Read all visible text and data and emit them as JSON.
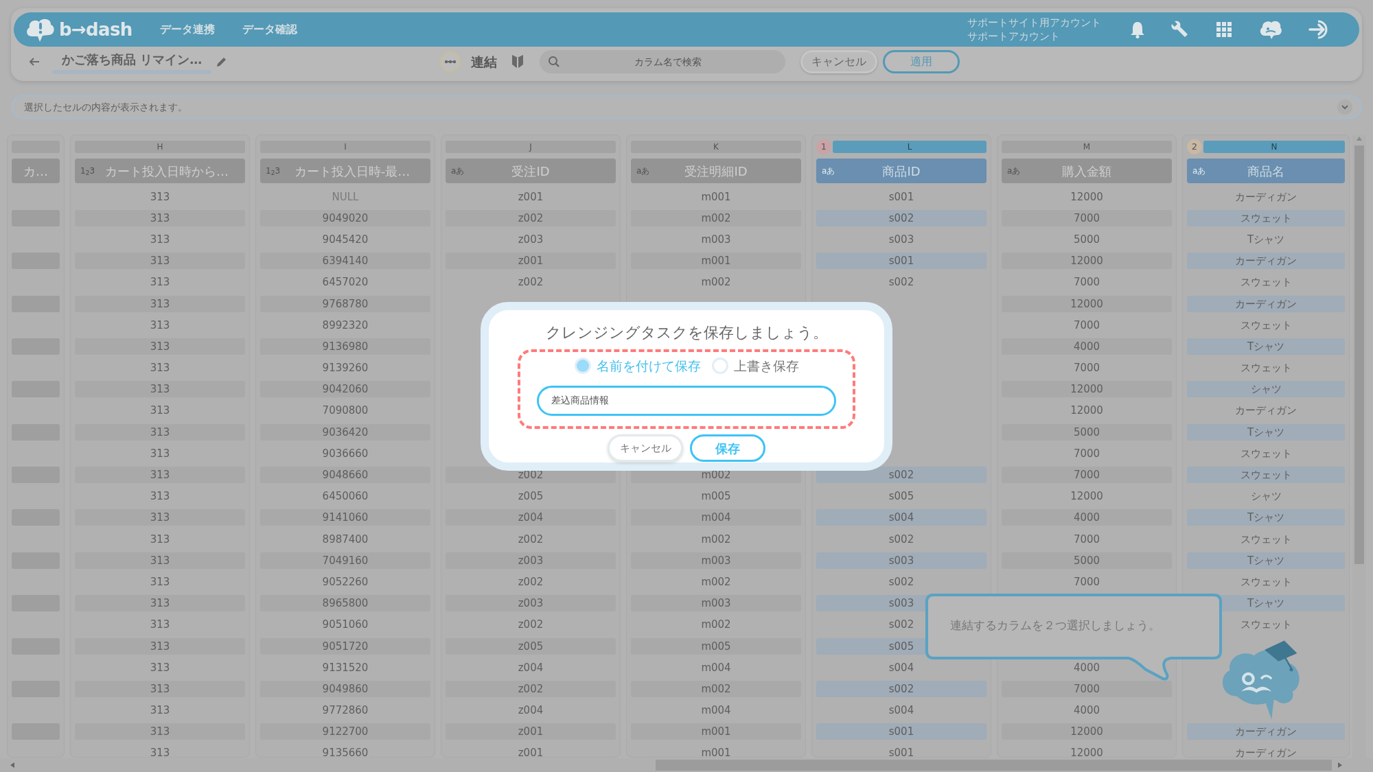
{
  "header": {
    "logo": "b→dash",
    "nav": [
      "データ連携",
      "データ確認"
    ],
    "account": [
      "サポートサイト用アカウント",
      "サポートアカウント"
    ]
  },
  "toolbar": {
    "title": "かご落ち商品 リマイン…",
    "mode": "連結",
    "search": {
      "placeholder": "カラム名で検索"
    },
    "buttons": [
      {
        "label": "キャンセル",
        "kind": "secondary"
      },
      {
        "label": "適用",
        "kind": "primary"
      }
    ]
  },
  "cell_viewer": {
    "placeholder": "選択したセルの内容が表示されます。"
  },
  "columns": [
    {
      "title": "カ…",
      "selected": false
    },
    {
      "letter": "H",
      "type_label": "1$_{2}$3",
      "title": "カート投入日時から…",
      "selected": false,
      "cells": [
        "313",
        "313",
        "313",
        "313",
        "313",
        "313",
        "313",
        "313",
        "313",
        "313",
        "313",
        "313",
        "313",
        "313",
        "313",
        "313",
        "313",
        "313",
        "313",
        "313",
        "313",
        "313",
        "313",
        "313",
        "313",
        "313",
        "313"
      ]
    },
    {
      "letter": "I",
      "type_label": "1$_{2}$3",
      "title": "カート投入日時-最…",
      "selected": false,
      "cells": [
        "NULL",
        "9049020",
        "9045420",
        "6394140",
        "6457020",
        "9768780",
        "8992320",
        "9136980",
        "9139260",
        "9042060",
        "7090800",
        "9036420",
        "9036660",
        "9048660",
        "6450060",
        "9141060",
        "8987400",
        "7049160",
        "9052260",
        "8965800",
        "9051060",
        "9051720",
        "9131520",
        "9049860",
        "9772860",
        "9122700",
        "9135660"
      ]
    },
    {
      "letter": "J",
      "type_label": "aあ",
      "title": "受注ID",
      "selected": false,
      "cells": [
        "z001",
        "z002",
        "z003",
        "z001",
        "z002",
        null,
        null,
        null,
        null,
        null,
        null,
        null,
        null,
        "z002",
        "z005",
        "z004",
        "z002",
        "z003",
        "z002",
        "z003",
        "z002",
        "z005",
        "z004",
        "z002",
        "z004",
        "z001",
        "z001"
      ]
    },
    {
      "letter": "K",
      "type_label": "aあ",
      "title": "受注明細ID",
      "selected": false,
      "cells": [
        "m001",
        "m002",
        "m003",
        "m001",
        "m002",
        null,
        null,
        null,
        null,
        null,
        null,
        null,
        null,
        "m002",
        "m005",
        "m004",
        "m002",
        "m003",
        "m002",
        "m003",
        "m002",
        "m005",
        "m004",
        "m002",
        "m004",
        "m001",
        "m001"
      ]
    },
    {
      "letter": "L",
      "type_label": "aあ",
      "title": "商品ID",
      "selected": true,
      "badge": {
        "text": "1",
        "color": "#c9a3a6"
      },
      "cells": [
        "s001",
        "s002",
        "s003",
        "s001",
        "s002",
        null,
        null,
        null,
        null,
        null,
        null,
        null,
        null,
        "s002",
        "s005",
        "s004",
        "s002",
        "s003",
        "s002",
        "s003",
        "s002",
        "s005",
        "s004",
        "s002",
        "s004",
        "s001",
        "s001"
      ]
    },
    {
      "letter": "M",
      "type_label": "aあ",
      "title": "購入金額",
      "selected": false,
      "cells": [
        "12000",
        "7000",
        "5000",
        "12000",
        "7000",
        "12000",
        "7000",
        "4000",
        "7000",
        "12000",
        "12000",
        "5000",
        "7000",
        "7000",
        "12000",
        "4000",
        "7000",
        "5000",
        "7000",
        null,
        null,
        null,
        "4000",
        "7000",
        "4000",
        "12000",
        "12000"
      ]
    },
    {
      "letter": "N",
      "type_label": "aあ",
      "title": "商品名",
      "selected": true,
      "badge": {
        "text": "2",
        "color": "#c8b8a4"
      },
      "cells": [
        "カーディガン",
        "スウェット",
        "Tシャツ",
        "カーディガン",
        "スウェット",
        "カーディガン",
        "スウェット",
        "Tシャツ",
        "スウェット",
        "シャツ",
        "カーディガン",
        "Tシャツ",
        "スウェット",
        "スウェット",
        "シャツ",
        "Tシャツ",
        "スウェット",
        "Tシャツ",
        "スウェット",
        "Tシャツ",
        "スウェット",
        null,
        null,
        null,
        null,
        "カーディガン",
        "カーディガン"
      ]
    }
  ],
  "dialog": {
    "title": "クレンジングタスクを保存しましょう。",
    "options": [
      {
        "label": "名前を付けて保存",
        "selected": true
      },
      {
        "label": "上書き保存",
        "selected": false
      }
    ],
    "name_value": "差込商品情報",
    "buttons": [
      {
        "label": "キャンセル",
        "kind": "secondary"
      },
      {
        "label": "保存",
        "kind": "primary"
      }
    ]
  },
  "tooltip": {
    "text": "連結するカラムを２つ選択しましょう。"
  }
}
